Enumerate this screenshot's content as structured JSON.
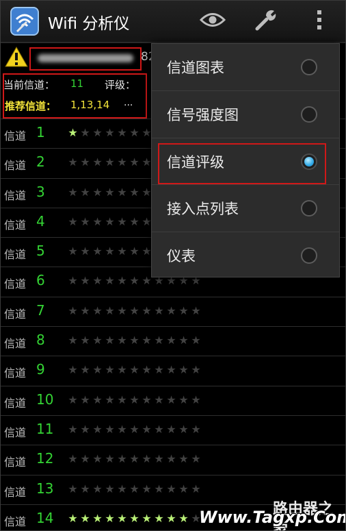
{
  "app": {
    "title": "Wifi 分析仪"
  },
  "status": {
    "ssid_tail": "82",
    "current_channel_label": "当前信道：",
    "current_channel_value": "11",
    "rating_label": "评级：",
    "recommended_label": "推荐信道：",
    "recommended_value": "1,13,14",
    "more": "..."
  },
  "row_label": "信道",
  "channels": [
    {
      "num": "1",
      "stars": 1
    },
    {
      "num": "2",
      "stars": 0
    },
    {
      "num": "3",
      "stars": 0
    },
    {
      "num": "4",
      "stars": 0
    },
    {
      "num": "5",
      "stars": 0
    },
    {
      "num": "6",
      "stars": 0
    },
    {
      "num": "7",
      "stars": 0
    },
    {
      "num": "8",
      "stars": 0
    },
    {
      "num": "9",
      "stars": 0
    },
    {
      "num": "10",
      "stars": 0
    },
    {
      "num": "11",
      "stars": 0
    },
    {
      "num": "12",
      "stars": 0
    },
    {
      "num": "13",
      "stars": 0
    },
    {
      "num": "14",
      "stars": 10
    }
  ],
  "max_stars": 11,
  "menu": {
    "items": [
      {
        "label": "信道图表",
        "selected": false
      },
      {
        "label": "信号强度图",
        "selected": false
      },
      {
        "label": "信道评级",
        "selected": true
      },
      {
        "label": "接入点列表",
        "selected": false
      },
      {
        "label": "仪表",
        "selected": false
      }
    ]
  },
  "watermark": {
    "main": "Www.Tagxp.Com",
    "small": "路由器之家"
  },
  "colors": {
    "accent_green": "#34d334",
    "recommend_yellow": "#f2e33a",
    "highlight_red": "#d01818",
    "radio_blue": "#2fa8e6",
    "star_on": "#b9f077"
  },
  "icons": {
    "app": "wifi-analyzer-icon",
    "view": "eye-icon",
    "tools": "wrench-icon",
    "overflow": "overflow-menu-icon",
    "warning": "warning-icon",
    "star": "star-icon"
  }
}
